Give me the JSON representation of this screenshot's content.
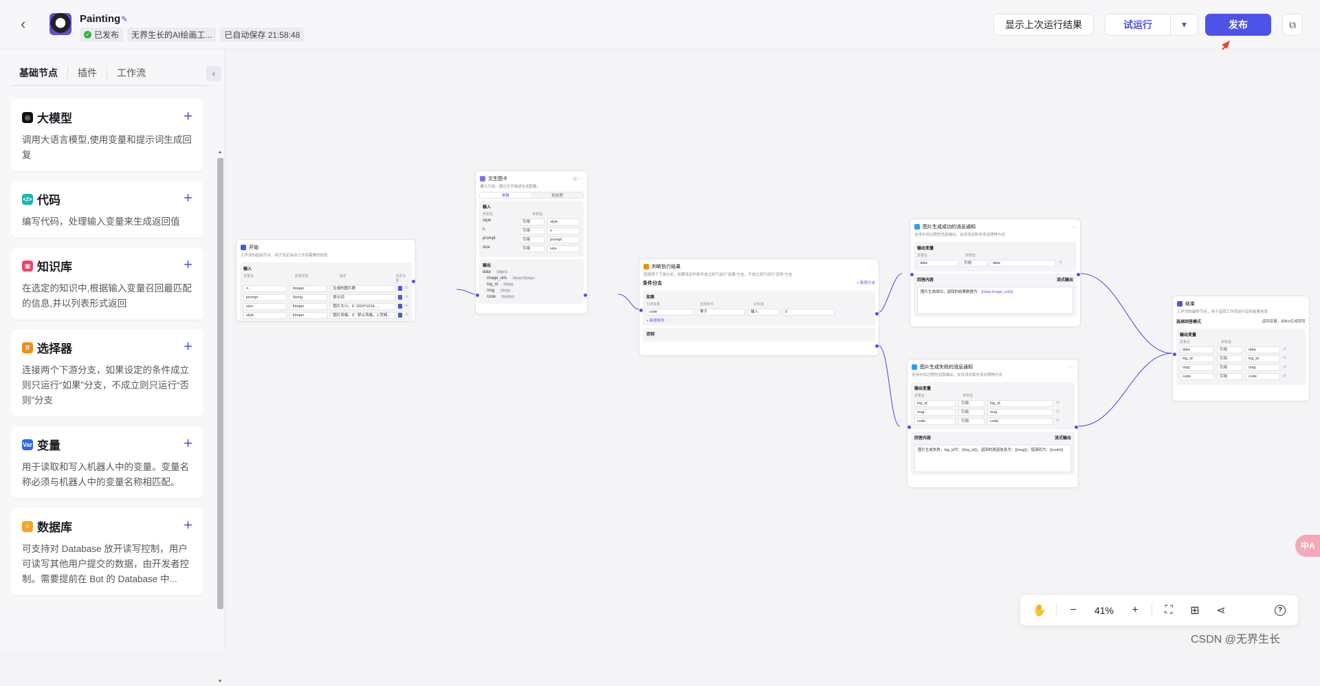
{
  "app": {
    "title": "Painting",
    "status": "已发布",
    "workflow_name": "无界生长的AI绘画工...",
    "autosave": "已自动保存 21:58:48"
  },
  "header": {
    "show_last_label": "显示上次运行结果",
    "run_label": "试运行",
    "publish_label": "发布"
  },
  "sidebar": {
    "tabs": [
      "基础节点",
      "插件",
      "工作流"
    ],
    "items": [
      {
        "title": "大模型",
        "desc": "调用大语言模型,使用变量和提示词生成回复",
        "icon": "llm-icon",
        "color": "#111111",
        "glyph": "◎"
      },
      {
        "title": "代码",
        "desc": "编写代码，处理输入变量来生成返回值",
        "icon": "code-icon",
        "color": "#1fb5b0",
        "glyph": "</>"
      },
      {
        "title": "知识库",
        "desc": "在选定的知识中,根据输入变量召回最匹配的信息,并以列表形式返回",
        "icon": "knowledge-icon",
        "color": "#f0436a",
        "glyph": "▣"
      },
      {
        "title": "选择器",
        "desc": "连接两个下游分支，如果设定的条件成立则只运行“如果”分支，不成立则只运行“否则”分支",
        "icon": "selector-icon",
        "color": "#f28c14",
        "glyph": "If"
      },
      {
        "title": "变量",
        "desc": "用于读取和写入机器人中的变量。变量名称必须与机器人中的变量名称相匹配。",
        "icon": "variable-icon",
        "color": "#2a66f0",
        "glyph": "Var"
      },
      {
        "title": "数据库",
        "desc": "可支持对 Database 放开读写控制，用户可读写其他用户提交的数据，由开发者控制。需要提前在 Bot 的 Database 中...",
        "icon": "database-icon",
        "color": "#f5a623",
        "glyph": "≡"
      }
    ]
  },
  "nodes": {
    "start": {
      "title": "开始",
      "desc": "工作流的起始节点，用于设定启动工作流需要的信息",
      "section": "输入",
      "col_headers": [
        "变量名",
        "变量类型",
        "描述",
        "是否必要"
      ],
      "rows": [
        {
          "name": "n",
          "type": "Integer",
          "desc": "生成的图片数"
        },
        {
          "name": "prompt",
          "type": "String",
          "desc": "提示词"
        },
        {
          "name": "size",
          "type": "Integer",
          "desc": "图片大小，0: 1024*1024, ..."
        },
        {
          "name": "style",
          "type": "Integer",
          "desc": "图片风格，0：默认风格，1:宫崎..."
        }
      ]
    },
    "image_gen": {
      "title": "文生图-fl",
      "desc": "通义万相，通过文字描述生成图像。",
      "tabs": [
        "参数",
        "批处理"
      ],
      "input_section": "输入",
      "input_headers": [
        "参数名",
        "参数值"
      ],
      "inputs": [
        {
          "name": "style",
          "mode": "引用",
          "value": "style"
        },
        {
          "name": "n",
          "mode": "引用",
          "value": "n"
        },
        {
          "name": "prompt",
          "mode": "引用",
          "value": "prompt"
        },
        {
          "name": "size",
          "mode": "引用",
          "value": "size"
        }
      ],
      "output_section": "输出",
      "outputs": [
        {
          "name": "data",
          "type": "Object"
        },
        {
          "name": "image_urls",
          "type": "Array<String>"
        },
        {
          "name": "log_id",
          "type": "String"
        },
        {
          "name": "msg",
          "type": "String"
        },
        {
          "name": "code",
          "type": "Number"
        }
      ]
    },
    "condition": {
      "title": "判断执行结果",
      "desc": "连接两个下游分支，如果设定的条件成立则只运行“如果”分支，不成立则只运行“否则”分支",
      "section": "条件分支",
      "add_branch": "+ 新增分支",
      "if_label": "如果",
      "headers": [
        "引用变量",
        "选择条件",
        "比较值"
      ],
      "cond": {
        "var": "code",
        "op": "等于",
        "mode": "输入",
        "value": "0"
      },
      "add_cond": "+ 新增条件",
      "else_label": "否则"
    },
    "msg_ok": {
      "title": "图片生成成功的消息通知",
      "desc": "支持中间过程的消息输出，支持流式和非流式两种方式",
      "out_section": "输出变量",
      "headers": [
        "变量名",
        "参数值"
      ],
      "rows": [
        {
          "name": "data",
          "mode": "引用",
          "value": "data"
        }
      ],
      "content_section": "回答内容",
      "stream_label": "流式输出",
      "content_prefix": "图片生成成功，返回的结果数据为：",
      "content_var": "{{data.image_urls}}"
    },
    "msg_fail": {
      "title": "图片生成失败的消息通知",
      "desc": "支持中间过程的消息输出，支持流式和非流式两种方式",
      "out_section": "输出变量",
      "headers": [
        "变量名",
        "参数值"
      ],
      "rows": [
        {
          "name": "log_id",
          "mode": "引用",
          "value": "log_id"
        },
        {
          "name": "msg",
          "mode": "引用",
          "value": "msg"
        },
        {
          "name": "code",
          "mode": "引用",
          "value": "code"
        }
      ],
      "content_section": "回答内容",
      "stream_label": "流式输出",
      "content_text": "图片生成失败，log_id为：{{log_id}}，返回的原因信息为：{{msg}}，错误码为：{{code}}"
    },
    "end": {
      "title": "结束",
      "desc": "工作流的最终节点，用于返回工作流运行后的结果信息",
      "mode_label": "选择回答模式",
      "mode_value": "返回变量，由Bot生成回答",
      "section": "输出变量",
      "headers": [
        "变量名",
        "参数值"
      ],
      "rows": [
        {
          "name": "data",
          "mode": "引用",
          "value": "data"
        },
        {
          "name": "log_id",
          "mode": "引用",
          "value": "log_id"
        },
        {
          "name": "msg",
          "mode": "引用",
          "value": "msg"
        },
        {
          "name": "code",
          "mode": "引用",
          "value": "code"
        }
      ]
    }
  },
  "toolbar": {
    "zoom": "41%"
  },
  "badge": "中A",
  "watermark": "CSDN @无界生长",
  "colors": {
    "accent": "#4d53e8",
    "publish_bg": "#4d53e8",
    "arrow": "#e8432b"
  }
}
